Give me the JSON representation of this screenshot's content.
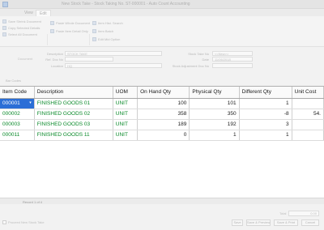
{
  "window": {
    "title": "New Stock Take - Stock Taking No. ST-000001 - Auto Count Accounting"
  },
  "tabs": [
    {
      "label": "View"
    },
    {
      "label": "Edit"
    }
  ],
  "ribbon": {
    "items": [
      {
        "label": "Save Shrink Document"
      },
      {
        "label": "Copy Selected Details"
      },
      {
        "label": "Select All Document"
      },
      {
        "label": "Paste Whole Document"
      },
      {
        "label": "Paste Item Detail Only"
      },
      {
        "label": "Item Hist. Search"
      },
      {
        "label": "Item Batch"
      },
      {
        "label": "Edit Mid Option"
      }
    ],
    "groups": [
      {
        "label": "Document"
      },
      {
        "label": "Options"
      }
    ]
  },
  "form": {
    "description_label": "Description",
    "description_value": "STOCK TAKE",
    "ref_label": "Ref. Doc No",
    "location_label": "Location",
    "location_value": "HQ",
    "stock_take_no_label": "Stock Take No",
    "stock_take_no_value": "<<New>>",
    "date_label": "Date",
    "date_value": "11/06/2018",
    "note_label": "Stock Adjustment Doc No"
  },
  "bar_codes_label": "Bar Codes",
  "grid": {
    "columns": [
      "Item Code",
      "Description",
      "UOM",
      "On Hand Qty",
      "Physical Qty",
      "Different Qty",
      "Unit Cost"
    ],
    "rows": [
      {
        "code": "000001",
        "description": "FINISHED GOODS 01",
        "uom": "UNIT",
        "on_hand": "100",
        "physical": "101",
        "diff": "1",
        "unit_cost": ""
      },
      {
        "code": "000002",
        "description": "FINISHED GOODS 02",
        "uom": "UNIT",
        "on_hand": "358",
        "physical": "350",
        "diff": "-8",
        "unit_cost": "54."
      },
      {
        "code": "000003",
        "description": "FINISHED GOODS 03",
        "uom": "UNIT",
        "on_hand": "189",
        "physical": "192",
        "diff": "3",
        "unit_cost": ""
      },
      {
        "code": "000011",
        "description": "FINISHED GOODS 11",
        "uom": "UNIT",
        "on_hand": "0",
        "physical": "1",
        "diff": "1",
        "unit_cost": ""
      }
    ]
  },
  "status": {
    "record": "Record 1 of 4"
  },
  "footer": {
    "checkbox_label": "Proceed New Stock Take",
    "total_label": "Total",
    "total_value": "0.00",
    "buttons": [
      {
        "label": "Save"
      },
      {
        "label": "Save & Preview"
      },
      {
        "label": "Save & Print"
      },
      {
        "label": "Cancel"
      }
    ]
  }
}
